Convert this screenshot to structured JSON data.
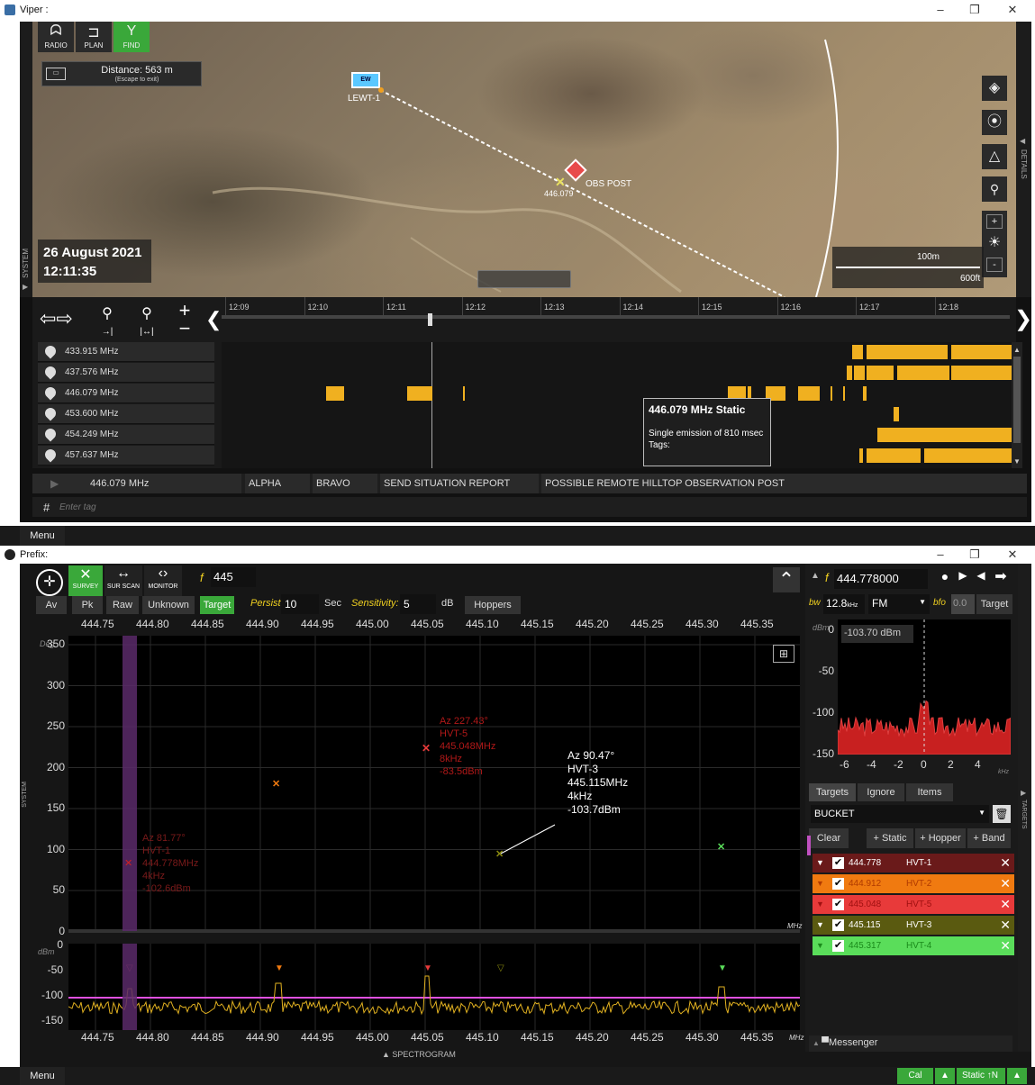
{
  "viper": {
    "window_title": "Viper :",
    "toolbar": {
      "radio": "RADIO",
      "plan": "PLAN",
      "find": "FIND"
    },
    "distance": {
      "label": "Distance: 563 m",
      "hint": "(Escape to exit)"
    },
    "date": "26 August 2021",
    "time": "12:11:35",
    "map_labels": {
      "ew_box": "EW",
      "lewt": "LEWT-1",
      "marker_freq": "446.079",
      "obs_post": "OBS POST"
    },
    "scale": {
      "metric": "100m",
      "imperial": "600ft"
    },
    "side_labels": {
      "system": "SYSTEM",
      "details": "DETAILS"
    },
    "time_ticks": [
      "12:09",
      "12:10",
      "12:11",
      "12:12",
      "12:13",
      "12:14",
      "12:15",
      "12:16",
      "12:17",
      "12:18"
    ],
    "frequencies": [
      "433.915 MHz",
      "437.576 MHz",
      "446.079 MHz",
      "453.600 MHz",
      "454.249 MHz",
      "457.637 MHz"
    ],
    "tooltip": {
      "title": "446.079 MHz Static",
      "line1": "Single emission of 810 msec",
      "line2": "Tags:"
    },
    "tag_bar": {
      "freq": "446.079 MHz",
      "tags": [
        "ALPHA",
        "BRAVO",
        "SEND SITUATION REPORT",
        "POSSIBLE REMOTE HILLTOP OBSERVATION POST"
      ]
    },
    "tag_input": {
      "hash": "#",
      "placeholder": "Enter tag"
    },
    "menu": "Menu"
  },
  "prefix": {
    "window_title": "Prefix:",
    "modes": {
      "survey": "SURVEY",
      "surscan": "SUR SCAN",
      "monitor": "MONITOR"
    },
    "f_label": "f",
    "f_value": "445",
    "filters": [
      "Av",
      "Pk",
      "Raw",
      "Unknown",
      "Target"
    ],
    "persist_label": "Persist",
    "persist_value": "10",
    "sec": "Sec",
    "sensitivity_label": "Sensitivity:",
    "sensitivity_value": "5",
    "db": "dB",
    "hoppers": "Hoppers",
    "freq_ticks": [
      "444.75",
      "444.80",
      "444.85",
      "444.90",
      "444.95",
      "445.00",
      "445.05",
      "445.10",
      "445.15",
      "445.20",
      "445.25",
      "445.30",
      "445.35"
    ],
    "az_ticks": [
      "350",
      "300",
      "250",
      "200",
      "150",
      "100",
      "50",
      "0"
    ],
    "az_unit": "Deg",
    "mhz": "MHz",
    "dbm_unit": "dBm",
    "spec_ticks": [
      "0",
      "-50",
      "-100",
      "-150"
    ],
    "spectrogram": "SPECTROGRAM",
    "annotations": {
      "hvt1": [
        "Az 81.77°",
        "HVT-1",
        "444.778MHz",
        "4kHz",
        "-102.6dBm"
      ],
      "hvt5": [
        "Az 227.43°",
        "HVT-5",
        "445.048MHz",
        "8kHz",
        "-83.5dBm"
      ],
      "hvt3": [
        "Az 90.47°",
        "HVT-3",
        "445.115MHz",
        "4kHz",
        "-103.7dBm"
      ]
    },
    "right": {
      "f_label": "f",
      "f_value": "444.778000",
      "bw_label": "bw",
      "bw_value": "12.8",
      "bw_unit": "kHz",
      "mode": "FM",
      "bfo_label": "bfo",
      "bfo_value": "0.0",
      "target_btn": "Target",
      "mini_y": [
        "0",
        "-50",
        "-100",
        "-150"
      ],
      "mini_x": [
        "-6",
        "-4",
        "-2",
        "0",
        "2",
        "4"
      ],
      "mini_unit": "kHz",
      "mini_dbm": "dBm",
      "mini_readout": "-103.70 dBm",
      "tabs": [
        "Targets",
        "Ignore",
        "Items"
      ],
      "bucket": "BUCKET",
      "actions": [
        "Clear",
        "+ Static",
        "+ Hopper",
        "+ Band"
      ],
      "targets": [
        {
          "freq": "444.778",
          "name": "HVT-1",
          "bg": "#6a1a1a",
          "fg": "#ffffff"
        },
        {
          "freq": "444.912",
          "name": "HVT-2",
          "bg": "#f07a10",
          "fg": "#b03a00"
        },
        {
          "freq": "445.048",
          "name": "HVT-5",
          "bg": "#e83a3a",
          "fg": "#a01010"
        },
        {
          "freq": "445.115",
          "name": "HVT-3",
          "bg": "#5a5a10",
          "fg": "#ffffff"
        },
        {
          "freq": "445.317",
          "name": "HVT-4",
          "bg": "#5add5a",
          "fg": "#1a8a1a"
        }
      ],
      "targets_side": "TARGETS",
      "messenger": "Messenger"
    },
    "status": {
      "menu": "Menu",
      "cal": "Cal",
      "static": "Static",
      "north": "↑N"
    }
  }
}
